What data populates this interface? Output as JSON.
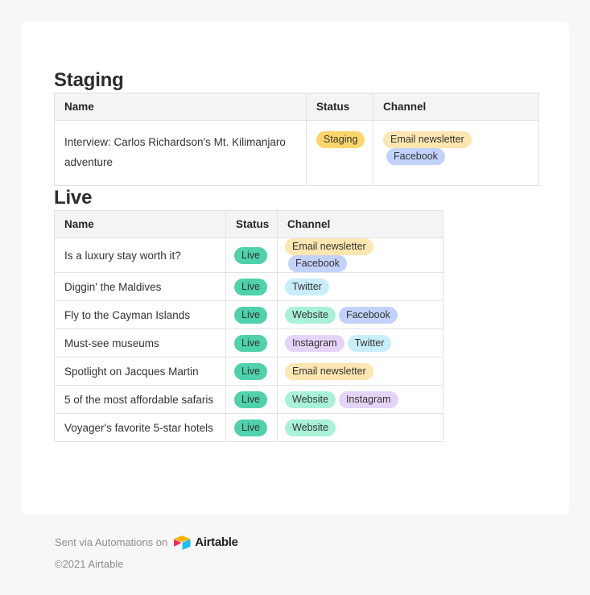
{
  "page": {
    "background_color": "#f7f7f7",
    "card_background": "#ffffff"
  },
  "sections": [
    {
      "id": "staging",
      "title": "Staging",
      "columns": [
        "Name",
        "Status",
        "Channel"
      ],
      "rows": [
        {
          "name": "Interview: Carlos Richardson's Mt. Kilimanjaro adventure",
          "status": "Staging",
          "channels": [
            "Email newsletter",
            "Facebook"
          ]
        }
      ]
    },
    {
      "id": "live",
      "title": "Live",
      "columns": [
        "Name",
        "Status",
        "Channel"
      ],
      "rows": [
        {
          "name": "Is a luxury stay worth it?",
          "status": "Live",
          "channels": [
            "Email newsletter",
            "Facebook"
          ]
        },
        {
          "name": "Diggin' the Maldives",
          "status": "Live",
          "channels": [
            "Twitter"
          ]
        },
        {
          "name": "Fly to the Cayman Islands",
          "status": "Live",
          "channels": [
            "Website",
            "Facebook"
          ]
        },
        {
          "name": "Must-see museums",
          "status": "Live",
          "channels": [
            "Instagram",
            "Twitter"
          ]
        },
        {
          "name": "Spotlight on Jacques Martin",
          "status": "Live",
          "channels": [
            "Email newsletter"
          ]
        },
        {
          "name": "5 of the most affordable safaris",
          "status": "Live",
          "channels": [
            "Website",
            "Instagram"
          ]
        },
        {
          "name": "Voyager's favorite 5-star hotels",
          "status": "Live",
          "channels": [
            "Website"
          ]
        }
      ]
    }
  ],
  "badge_colors": {
    "Staging": "#fcd66b",
    "Live": "#4fd1ab",
    "Email newsletter": "#fde6b0",
    "Facebook": "#c2d2fa",
    "Twitter": "#c8eefb",
    "Website": "#a9f2d5",
    "Instagram": "#e5d4f7"
  },
  "footer": {
    "sent_via": "Sent via Automations on",
    "brand": "Airtable",
    "copyright": "©2021 Airtable",
    "logo_icon": "airtable-logo-icon"
  }
}
